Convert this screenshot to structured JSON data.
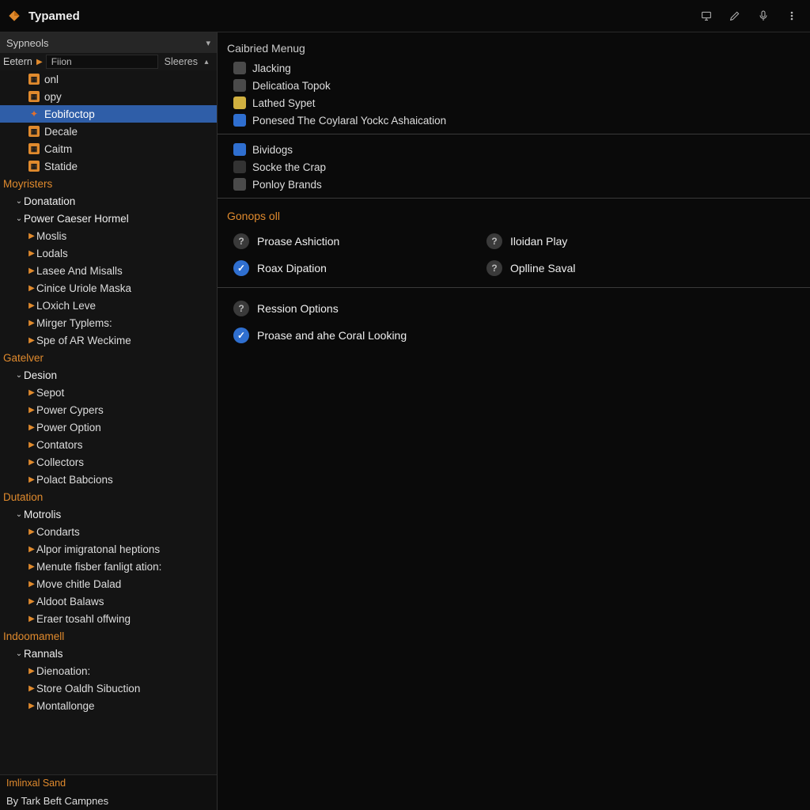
{
  "titlebar": {
    "title": "Typamed"
  },
  "sidebar": {
    "panel_title": "Sypneols",
    "filter": {
      "label": "Eetern",
      "value": "Fiion",
      "sort": "Sleeres"
    },
    "quick": [
      {
        "icon": "sq-or",
        "label": "onl"
      },
      {
        "icon": "sq-or",
        "label": "opy"
      },
      {
        "icon": "fire",
        "label": "Eobifoctop",
        "selected": true
      },
      {
        "icon": "sq-or",
        "label": "Decale"
      },
      {
        "icon": "sq-or",
        "label": "Caitm"
      },
      {
        "icon": "sq-or",
        "label": "Statide"
      }
    ],
    "groups": [
      {
        "heading": "Moyristers",
        "heading_items": [
          {
            "twist": "chk",
            "label": "Donatation"
          },
          {
            "twist": "chk",
            "label": "Power Caeser Hormel"
          }
        ],
        "children": [
          "Moslis",
          "Lodals",
          "Lasee And Misalls",
          "Cinice Uriole Maska",
          "LOxich Leve",
          "Mirger Typlems:",
          "Spe of AR Weckime"
        ]
      },
      {
        "heading": "Gatelver",
        "heading_items": [
          {
            "twist": "chk",
            "label": "Desion"
          }
        ],
        "children": [
          "Sepot",
          "Power Cypers",
          "Power Option",
          "Contators",
          "Collectors",
          "Polact Babcions"
        ]
      },
      {
        "heading": "Dutation",
        "heading_items": [
          {
            "twist": "chk",
            "label": "Motrolis"
          }
        ],
        "children": [
          "Condarts",
          "Alpor imigratonal heptions",
          "Menute fisber fanligt ation:",
          "Move chitle Dalad",
          "Aldoot Balaws",
          "Eraer tosahl offwing"
        ]
      },
      {
        "heading": "Indoomamell",
        "heading_items": [
          {
            "twist": "chk",
            "label": "Rannals"
          }
        ],
        "children": [
          "Dienoation:",
          "Store Oaldh Sibuction",
          "Montallonge"
        ]
      }
    ],
    "footer": {
      "line1": "Imlinxal Sand",
      "line2": "By Tark Beft Campnes"
    }
  },
  "content": {
    "menu_title": "Caibried Menug",
    "menu_items": [
      {
        "bullet": "sq-gr",
        "label": "Jlacking"
      },
      {
        "bullet": "sq-gr",
        "label": "Delicatioa Topok"
      },
      {
        "bullet": "sq-ye",
        "label": "Lathed Sypet"
      },
      {
        "bullet": "sq-bl",
        "label": "Ponesed The Coylaral Yockc Ashaication"
      }
    ],
    "sec2_items": [
      {
        "bullet": "sq-bl",
        "label": "Bividogs"
      },
      {
        "bullet": "sq-dk",
        "label": "Socke the Crap"
      },
      {
        "bullet": "sq-gr",
        "label": "Ponloy Brands"
      }
    ],
    "gonops_title": "Gonops oll",
    "gonops_opts": [
      {
        "state": "q",
        "label": "Proase Ashiction"
      },
      {
        "state": "q",
        "label": "Iloidan Play"
      },
      {
        "state": "on",
        "label": "Roax Dipation"
      },
      {
        "state": "q",
        "label": "Oplline Saval"
      }
    ],
    "ression_title": "Ression Options",
    "ression_opts": [
      {
        "state": "q",
        "label": "Ression Options",
        "is_title": true
      },
      {
        "state": "on",
        "label": "Proase and ahe Coral Looking"
      }
    ]
  }
}
